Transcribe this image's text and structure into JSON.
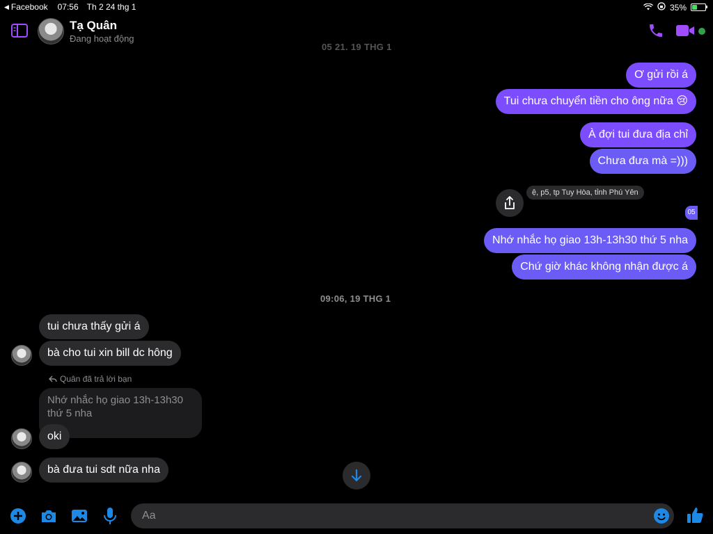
{
  "status_bar": {
    "back_app": "Facebook",
    "time": "07:56",
    "date": "Th 2 24 thg 1",
    "battery": "35%",
    "battery_level": 0.35
  },
  "header": {
    "contact_name": "Tạ Quân",
    "contact_status": "Đang hoạt động",
    "active_color": "#31a24c",
    "accent_color": "#a04cff"
  },
  "messages": {
    "top_stamp_partial": "05 21, 19 THG 1",
    "out1": "Ơ gửi rồi á",
    "out2": "Tui chưa chuyển tiền cho ông nữa 😢",
    "out3": "À đợi tui đưa địa chỉ",
    "out4": "Chưa đưa mà =)))",
    "address_preview": "ệ, p5, tp Tuy Hòa, tỉnh Phú Yên",
    "tiny_chip": "05",
    "out5": "Nhớ nhắc họ giao 13h-13h30 thứ 5 nha",
    "out6": "Chứ giờ khác không nhận được á",
    "stamp2": "09:06, 19 THG 1",
    "in1": "tui chưa thấy gửi á",
    "in2": "bà cho tui xin bill dc hông",
    "reply_label": "Quân đã trả lời bạn",
    "quoted_text": "Nhớ nhắc họ giao 13h-13h30 thứ 5 nha",
    "in3": "oki",
    "in4": "bà đưa tui sdt nữa nha"
  },
  "composer": {
    "placeholder": "Aa"
  },
  "colors": {
    "outgoing_bubble": "#7c4dff",
    "incoming_bubble": "#2b2b2e",
    "icon_blue": "#1e88e5"
  }
}
